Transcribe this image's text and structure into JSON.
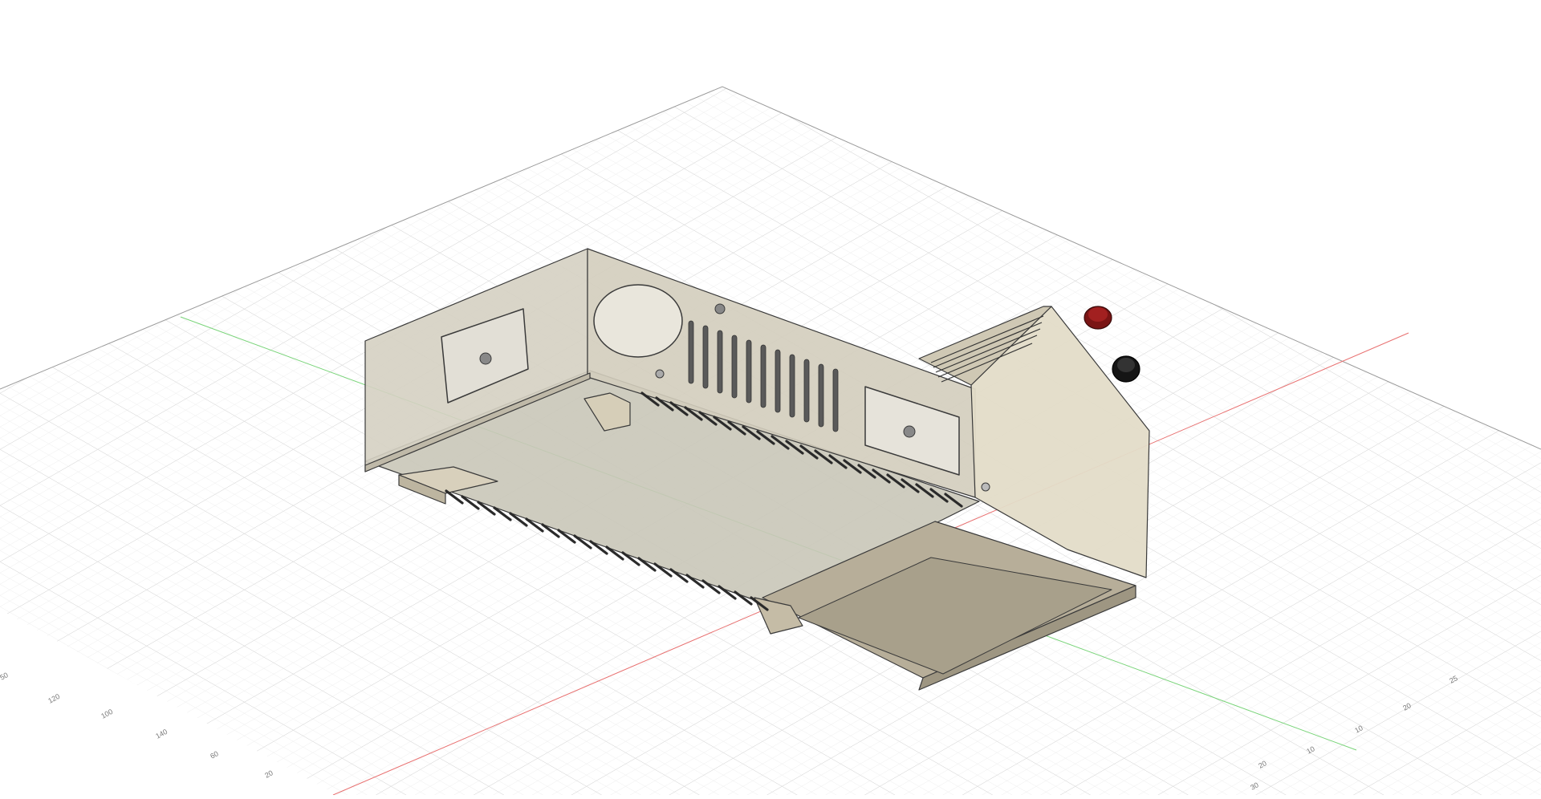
{
  "viewport": {
    "description_free": true,
    "ruler_left": [
      "50",
      "120",
      "100",
      "140",
      "60",
      "20"
    ],
    "ruler_right": [
      "25",
      "20",
      "10",
      "10",
      "20",
      "30"
    ]
  },
  "colors": {
    "grid_minor": "#e6e6e6",
    "grid_major": "#cfcfcf",
    "axis_x": "#e85a5a",
    "axis_y": "#6ad46a",
    "body_fill": "#d8d2c2",
    "body_fill_dark": "#b9b19d",
    "edge": "#3a3a3a",
    "terminal_red": "#7a1414",
    "terminal_black": "#151515"
  },
  "icons": [
    "orbit-viewcube-none"
  ]
}
